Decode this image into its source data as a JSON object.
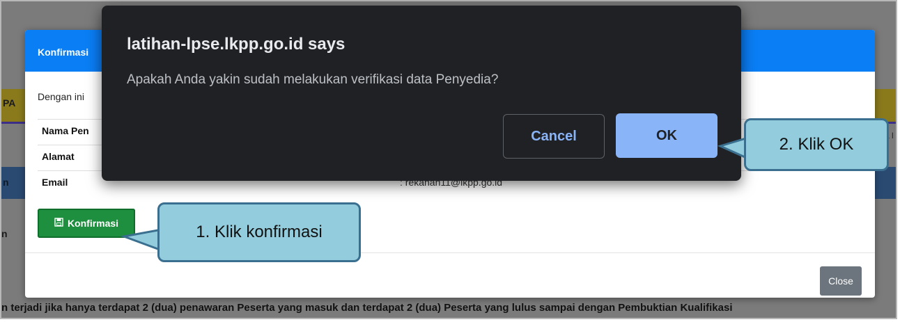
{
  "background": {
    "left_fragment_1": "PA",
    "left_fragment_2": "n",
    "left_fragment_3": "n",
    "right_fragment": "a l",
    "bottom_text": "n terjadi jika hanya terdapat 2 (dua) penawaran Peserta yang masuk dan terdapat 2 (dua) Peserta yang lulus sampai dengan Pembuktian Kualifikasi"
  },
  "modal": {
    "title": "Konfirmasi",
    "intro": "Dengan ini",
    "rows": [
      {
        "label": "Nama Pen",
        "value": ""
      },
      {
        "label": "Alamat",
        "value": ""
      },
      {
        "label": "Email",
        "value": ": rekanan11@lkpp.go.id"
      }
    ],
    "konfirmasi_label": "Konfirmasi",
    "close_label": "Close"
  },
  "alert": {
    "title": "latihan-lpse.lkpp.go.id says",
    "message": "Apakah Anda yakin sudah melakukan verifikasi data Penyedia?",
    "cancel_label": "Cancel",
    "ok_label": "OK"
  },
  "callouts": {
    "step1": "1. Klik konfirmasi",
    "step2": "2. Klik OK"
  },
  "colors": {
    "modal_header": "#0a7ef5",
    "konfirmasi_button": "#1e8f3e",
    "alert_bg": "#202124",
    "alert_ok": "#8ab4f8",
    "callout_fill": "#93cddd"
  }
}
